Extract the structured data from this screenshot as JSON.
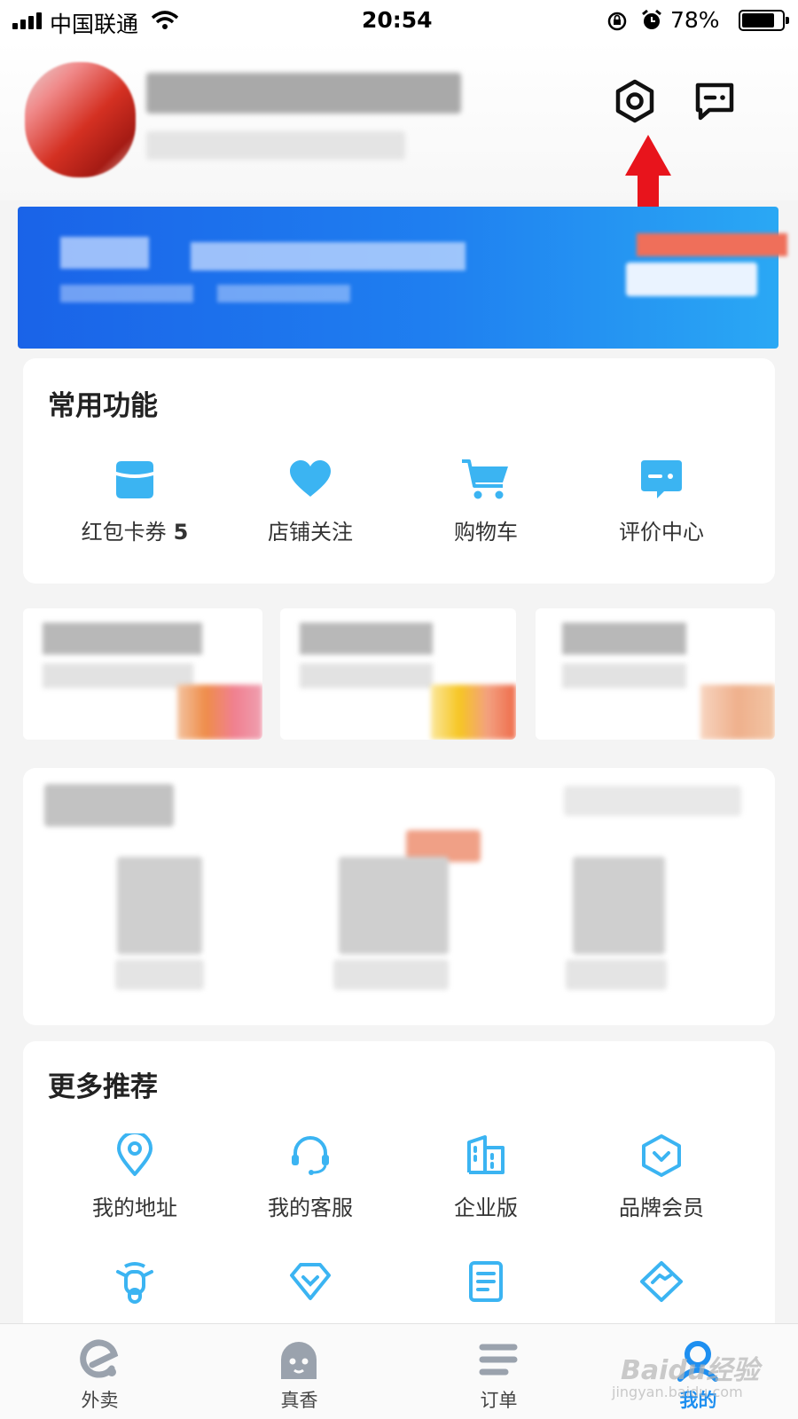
{
  "status_bar": {
    "carrier": "中国联通",
    "time": "20:54",
    "battery": "78%",
    "battery_level": 0.78
  },
  "header": {
    "settings_icon": "hexagon-settings-icon",
    "message_icon": "chat-message-icon",
    "arrow_color": "#e8141c"
  },
  "common_functions": {
    "title": "常用功能",
    "items": [
      {
        "label": "红包卡券",
        "count": "5",
        "icon": "coupon-icon"
      },
      {
        "label": "店铺关注",
        "icon": "heart-icon"
      },
      {
        "label": "购物车",
        "icon": "cart-icon"
      },
      {
        "label": "评价中心",
        "icon": "review-icon"
      }
    ]
  },
  "more_recommend": {
    "title": "更多推荐",
    "items": [
      {
        "label": "我的地址",
        "icon": "location-pin-icon"
      },
      {
        "label": "我的客服",
        "icon": "headset-icon"
      },
      {
        "label": "企业版",
        "icon": "building-icon"
      },
      {
        "label": "品牌会员",
        "icon": "shield-chevron-icon"
      }
    ],
    "second_row_icons": [
      "scooter-icon",
      "diamond-heart-icon",
      "document-icon",
      "handshake-icon"
    ]
  },
  "tabs": [
    {
      "label": "外卖",
      "icon": "e-logo-icon"
    },
    {
      "label": "真香",
      "icon": "face-icon"
    },
    {
      "label": "订单",
      "icon": "list-icon"
    },
    {
      "label": "我的",
      "icon": "profile-icon",
      "active": true
    }
  ],
  "watermark": {
    "brand": "Baidu经验",
    "url": "jingyan.baidu.com"
  },
  "colors": {
    "accent": "#1e8ff0",
    "icon_blue": "#3bb4f2",
    "banner_blue": "#1f7ff0",
    "arrow_red": "#e8141c"
  }
}
